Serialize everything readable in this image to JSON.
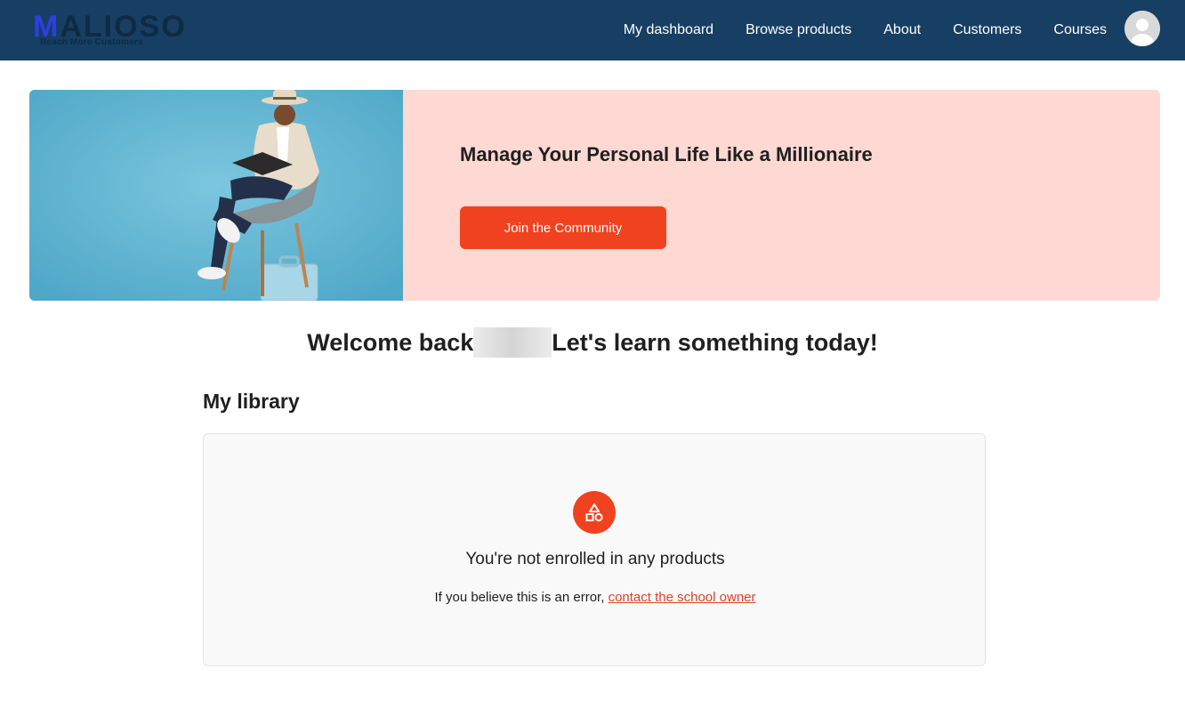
{
  "brand": {
    "logo_first": "M",
    "logo_rest": "ALIOSO",
    "tagline": "Reach More Customers"
  },
  "nav": {
    "items": [
      {
        "label": "My dashboard"
      },
      {
        "label": "Browse products"
      },
      {
        "label": "About"
      },
      {
        "label": "Customers"
      },
      {
        "label": "Courses"
      }
    ],
    "avatar_icon": "user-avatar-icon"
  },
  "hero": {
    "title": "Manage Your Personal Life Like a Millionaire",
    "cta_label": "Join the Community",
    "image_icon": "man-reading-on-chair-photo"
  },
  "welcome": {
    "prefix": "Welcome back",
    "suffix": "Let's learn something today!"
  },
  "library": {
    "title": "My library",
    "empty_icon": "shapes-icon",
    "empty_title": "You're not enrolled in any products",
    "empty_sub_prefix": "If you believe this is an error, ",
    "empty_link": "contact the school owner"
  },
  "colors": {
    "topbar": "#163f63",
    "accent": "#f1421f",
    "hero_bg": "#fed8d2",
    "hero_img_bg": "#66b7d3"
  }
}
